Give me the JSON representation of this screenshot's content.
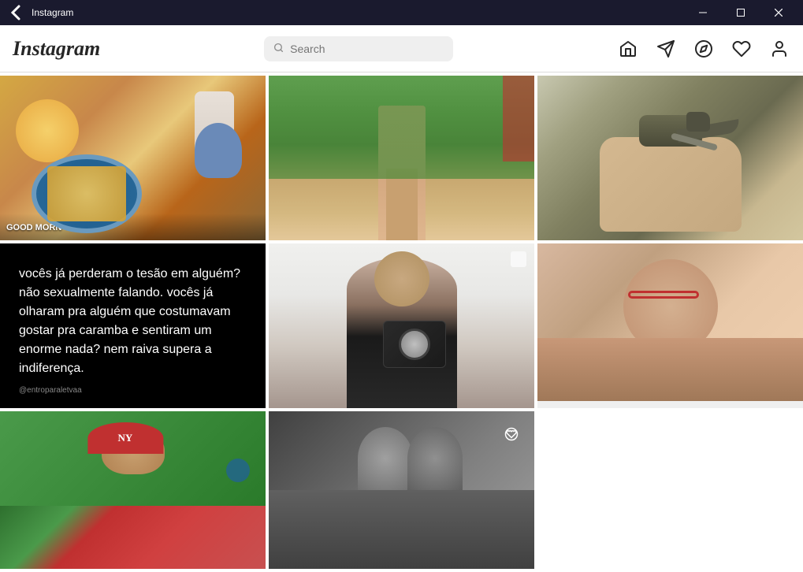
{
  "titlebar": {
    "back_label": "←",
    "title": "Instagram",
    "minimize_label": "—",
    "maximize_label": "❐",
    "close_label": "✕"
  },
  "topnav": {
    "logo": "Instagram",
    "search_placeholder": "Search",
    "nav_items": [
      {
        "name": "home-icon",
        "label": "Home"
      },
      {
        "name": "send-icon",
        "label": "Send"
      },
      {
        "name": "explore-icon",
        "label": "Explore"
      },
      {
        "name": "heart-icon",
        "label": "Activity"
      },
      {
        "name": "profile-icon",
        "label": "Profile"
      }
    ]
  },
  "grid": {
    "posts": [
      {
        "id": "post-food",
        "type": "image",
        "description": "Breakfast food photo with eggs and yogurt",
        "row": 0,
        "col": 0
      },
      {
        "id": "post-bikini",
        "type": "image",
        "description": "Woman in bikini outdoors",
        "row": 0,
        "col": 1
      },
      {
        "id": "post-lizard",
        "type": "image",
        "description": "Baby lizard in hand",
        "row": 0,
        "col": 2
      },
      {
        "id": "post-quote",
        "type": "text",
        "description": "Quote post black background",
        "quote": "vocês já perderam o tesão em alguém? não sexualmente falando. vocês já olharam pra alguém que costumavam gostar pra caramba e sentiram um enorme nada? nem raiva supera a indiferença.",
        "handle": "@entroparaletvaa",
        "row": 1,
        "col": 0
      },
      {
        "id": "post-kylian",
        "type": "image",
        "description": "Kylian Mbappe holding watch box",
        "row": 1,
        "col": 2
      },
      {
        "id": "post-woman-red",
        "type": "image",
        "description": "Woman with red glasses",
        "row": 2,
        "col": 0
      },
      {
        "id": "post-woman-cap",
        "type": "image",
        "description": "Woman with red cap outdoors",
        "row": 2,
        "col": 1
      },
      {
        "id": "post-couple",
        "type": "image",
        "description": "Couple in black and white",
        "row": 2,
        "col": 2
      }
    ]
  }
}
